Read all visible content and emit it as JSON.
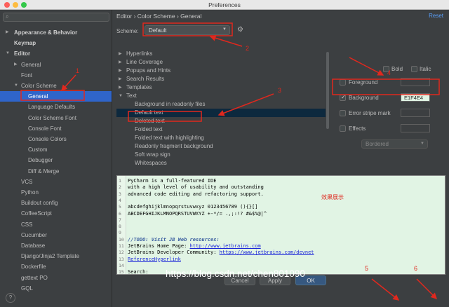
{
  "window": {
    "title": "Preferences"
  },
  "search": {
    "placeholder": ""
  },
  "sidebar": {
    "items": [
      {
        "label": "Appearance & Behavior",
        "arrow": "▶"
      },
      {
        "label": "Keymap",
        "arrow": ""
      },
      {
        "label": "Editor",
        "arrow": "▼"
      },
      {
        "label": "General",
        "arrow": "▶"
      },
      {
        "label": "Font",
        "arrow": ""
      },
      {
        "label": "Color Scheme",
        "arrow": "▼"
      },
      {
        "label": "General",
        "arrow": ""
      },
      {
        "label": "Language Defaults",
        "arrow": ""
      },
      {
        "label": "Color Scheme Font",
        "arrow": ""
      },
      {
        "label": "Console Font",
        "arrow": ""
      },
      {
        "label": "Console Colors",
        "arrow": ""
      },
      {
        "label": "Custom",
        "arrow": ""
      },
      {
        "label": "Debugger",
        "arrow": ""
      },
      {
        "label": "Diff & Merge",
        "arrow": ""
      },
      {
        "label": "VCS",
        "arrow": ""
      },
      {
        "label": "Python",
        "arrow": ""
      },
      {
        "label": "Buildout config",
        "arrow": ""
      },
      {
        "label": "CoffeeScript",
        "arrow": ""
      },
      {
        "label": "CSS",
        "arrow": ""
      },
      {
        "label": "Cucumber",
        "arrow": ""
      },
      {
        "label": "Database",
        "arrow": ""
      },
      {
        "label": "Django/Jinja2 Template",
        "arrow": ""
      },
      {
        "label": "Dockerfile",
        "arrow": ""
      },
      {
        "label": "gettext PO",
        "arrow": ""
      },
      {
        "label": "GQL",
        "arrow": ""
      }
    ],
    "help": "?"
  },
  "main": {
    "breadcrumb": "Editor  ›  Color Scheme  ›  General",
    "reset": "Reset",
    "scheme_label": "Scheme:",
    "scheme_value": "Default",
    "list": [
      {
        "label": "Hyperlinks",
        "arrow": "▶"
      },
      {
        "label": "Line Coverage",
        "arrow": "▶"
      },
      {
        "label": "Popups and Hints",
        "arrow": "▶"
      },
      {
        "label": "Search Results",
        "arrow": "▶"
      },
      {
        "label": "Templates",
        "arrow": "▶"
      },
      {
        "label": "Text",
        "arrow": "▼"
      },
      {
        "label": "Background in readonly files",
        "arrow": ""
      },
      {
        "label": "Default text",
        "arrow": ""
      },
      {
        "label": "Deleted text",
        "arrow": ""
      },
      {
        "label": "Folded text",
        "arrow": ""
      },
      {
        "label": "Folded text with highlighting",
        "arrow": ""
      },
      {
        "label": "Readonly fragment background",
        "arrow": ""
      },
      {
        "label": "Soft wrap sign",
        "arrow": ""
      },
      {
        "label": "Whitespaces",
        "arrow": ""
      }
    ],
    "options": {
      "bold": "Bold",
      "italic": "Italic",
      "foreground": "Foreground",
      "background": "Background",
      "background_hex": "E1F4E4",
      "error_stripe": "Error stripe mark",
      "effects": "Effects",
      "effect_type": "Bordered"
    },
    "preview": {
      "lines": [
        {
          "num": "1",
          "text": "PyCharm is a full-featured IDE"
        },
        {
          "num": "2",
          "text": "with a high level of usability and outstanding"
        },
        {
          "num": "3",
          "text": "advanced code editing and refactoring support."
        },
        {
          "num": "4",
          "text": ""
        },
        {
          "num": "5",
          "text": "abcdefghijklmnopqrstuvwxyz 0123456789 (){}[]"
        },
        {
          "num": "6",
          "text": "ABCDEFGHIJKLMNOPQRSTUVWXYZ +-*/= .,;:!? #&$%@|^"
        },
        {
          "num": "7",
          "text": ""
        },
        {
          "num": "8",
          "text": ""
        },
        {
          "num": "9",
          "text": ""
        },
        {
          "num": "10",
          "text": "//TODO: Visit JB Web resources:"
        },
        {
          "num": "11",
          "text_a": "JetBrains Home Page: ",
          "link": "http://www.jetbrains.com"
        },
        {
          "num": "12",
          "text_a": "JetBrains Developer Community: ",
          "link": "https://www.jetbrains.com/devnet"
        },
        {
          "num": "13",
          "link": "ReferenceHyperlink"
        },
        {
          "num": "14",
          "text": ""
        },
        {
          "num": "15",
          "text": "Search:"
        }
      ],
      "effect_label": "效果展示"
    }
  },
  "buttons": {
    "cancel": "Cancel",
    "apply": "Apply",
    "ok": "OK"
  },
  "watermark": "https://blog.csdn.net/chen801090",
  "annotations": [
    "1",
    "2",
    "3",
    "4",
    "5",
    "6"
  ],
  "colors": {
    "accent": "#2f65ca",
    "annotation": "#e0281e",
    "preview_bg": "#e1f4e4"
  }
}
